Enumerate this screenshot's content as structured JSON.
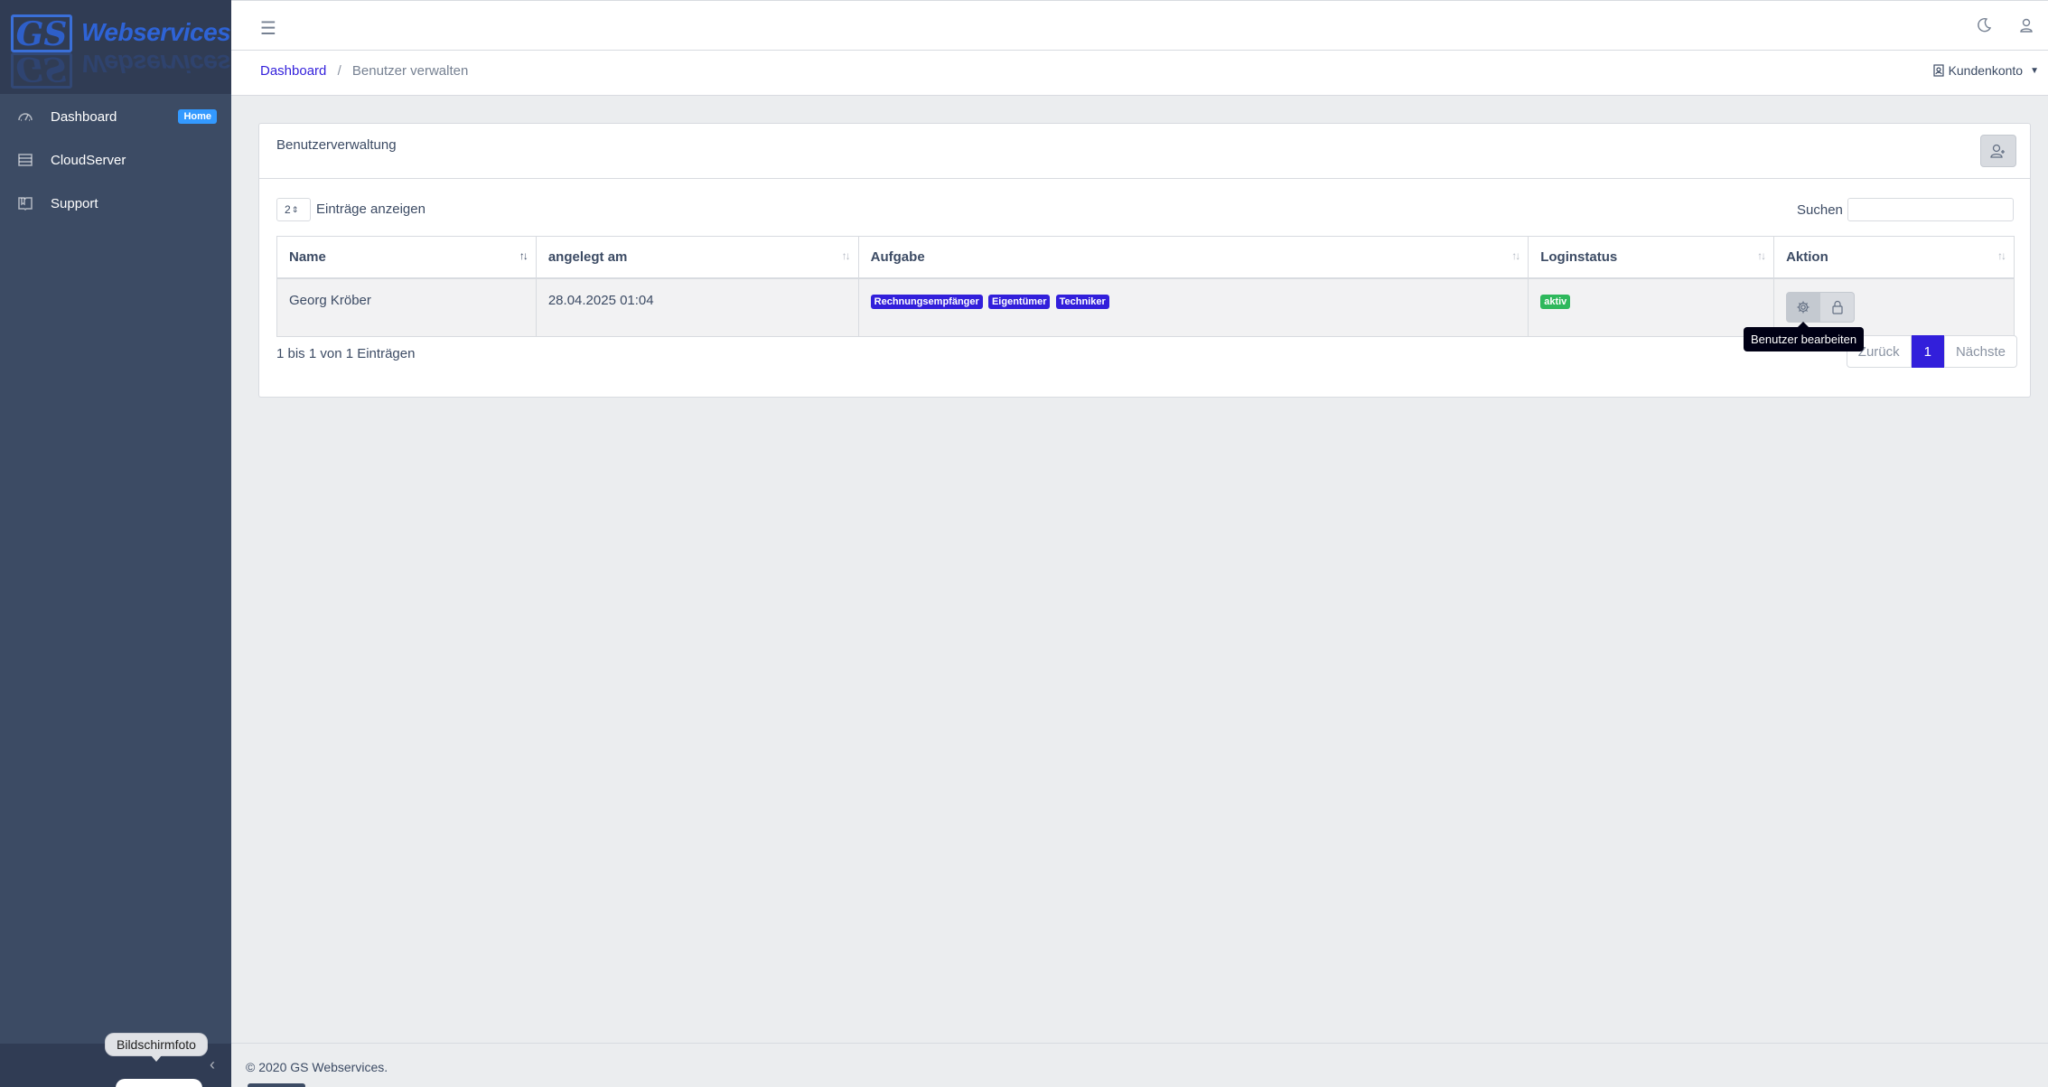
{
  "brand": {
    "logo": "GS",
    "name": "Webservices"
  },
  "sidebar": {
    "items": [
      {
        "label": "Dashboard",
        "badge": "Home",
        "icon": "speedometer-icon"
      },
      {
        "label": "CloudServer",
        "icon": "server-icon"
      },
      {
        "label": "Support",
        "icon": "book-icon"
      }
    ],
    "screenshot_tooltip": "Bildschirmfoto"
  },
  "header": {
    "breadcrumb": {
      "home": "Dashboard",
      "separator": "/",
      "current": "Benutzer verwalten"
    },
    "account_label": "Kundenkonto"
  },
  "card": {
    "title": "Benutzerverwaltung",
    "length_value": "2",
    "length_label": "Einträge anzeigen",
    "search_label": "Suchen",
    "search_value": "",
    "columns": [
      "Name",
      "angelegt am",
      "Aufgabe",
      "Loginstatus",
      "Aktion"
    ],
    "rows": [
      {
        "name": "Georg Kröber",
        "created": "28.04.2025 01:04",
        "roles": [
          "Rechnungsempfänger",
          "Eigentümer",
          "Techniker"
        ],
        "status": "aktiv"
      }
    ],
    "info": "1 bis 1 von 1 Einträgen",
    "pagination": {
      "prev": "Zurück",
      "current": "1",
      "next": "Nächste"
    },
    "tooltip": "Benutzer bearbeiten"
  },
  "footer": {
    "text": "© 2020 GS Webservices."
  },
  "colors": {
    "primary": "#321fdb",
    "sidebar": "#3c4b64",
    "success": "#2eb85c",
    "info": "#3399ff"
  }
}
